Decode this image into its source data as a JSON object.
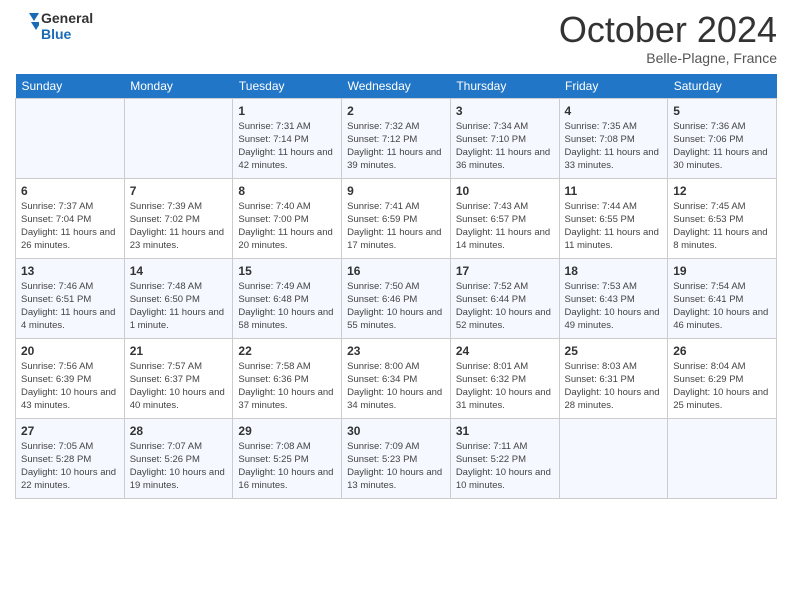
{
  "header": {
    "logo_general": "General",
    "logo_blue": "Blue",
    "month": "October 2024",
    "location": "Belle-Plagne, France"
  },
  "days_of_week": [
    "Sunday",
    "Monday",
    "Tuesday",
    "Wednesday",
    "Thursday",
    "Friday",
    "Saturday"
  ],
  "weeks": [
    [
      {
        "day": "",
        "empty": true
      },
      {
        "day": "",
        "empty": true
      },
      {
        "day": "1",
        "sunrise": "Sunrise: 7:31 AM",
        "sunset": "Sunset: 7:14 PM",
        "daylight": "Daylight: 11 hours and 42 minutes."
      },
      {
        "day": "2",
        "sunrise": "Sunrise: 7:32 AM",
        "sunset": "Sunset: 7:12 PM",
        "daylight": "Daylight: 11 hours and 39 minutes."
      },
      {
        "day": "3",
        "sunrise": "Sunrise: 7:34 AM",
        "sunset": "Sunset: 7:10 PM",
        "daylight": "Daylight: 11 hours and 36 minutes."
      },
      {
        "day": "4",
        "sunrise": "Sunrise: 7:35 AM",
        "sunset": "Sunset: 7:08 PM",
        "daylight": "Daylight: 11 hours and 33 minutes."
      },
      {
        "day": "5",
        "sunrise": "Sunrise: 7:36 AM",
        "sunset": "Sunset: 7:06 PM",
        "daylight": "Daylight: 11 hours and 30 minutes."
      }
    ],
    [
      {
        "day": "6",
        "sunrise": "Sunrise: 7:37 AM",
        "sunset": "Sunset: 7:04 PM",
        "daylight": "Daylight: 11 hours and 26 minutes."
      },
      {
        "day": "7",
        "sunrise": "Sunrise: 7:39 AM",
        "sunset": "Sunset: 7:02 PM",
        "daylight": "Daylight: 11 hours and 23 minutes."
      },
      {
        "day": "8",
        "sunrise": "Sunrise: 7:40 AM",
        "sunset": "Sunset: 7:00 PM",
        "daylight": "Daylight: 11 hours and 20 minutes."
      },
      {
        "day": "9",
        "sunrise": "Sunrise: 7:41 AM",
        "sunset": "Sunset: 6:59 PM",
        "daylight": "Daylight: 11 hours and 17 minutes."
      },
      {
        "day": "10",
        "sunrise": "Sunrise: 7:43 AM",
        "sunset": "Sunset: 6:57 PM",
        "daylight": "Daylight: 11 hours and 14 minutes."
      },
      {
        "day": "11",
        "sunrise": "Sunrise: 7:44 AM",
        "sunset": "Sunset: 6:55 PM",
        "daylight": "Daylight: 11 hours and 11 minutes."
      },
      {
        "day": "12",
        "sunrise": "Sunrise: 7:45 AM",
        "sunset": "Sunset: 6:53 PM",
        "daylight": "Daylight: 11 hours and 8 minutes."
      }
    ],
    [
      {
        "day": "13",
        "sunrise": "Sunrise: 7:46 AM",
        "sunset": "Sunset: 6:51 PM",
        "daylight": "Daylight: 11 hours and 4 minutes."
      },
      {
        "day": "14",
        "sunrise": "Sunrise: 7:48 AM",
        "sunset": "Sunset: 6:50 PM",
        "daylight": "Daylight: 11 hours and 1 minute."
      },
      {
        "day": "15",
        "sunrise": "Sunrise: 7:49 AM",
        "sunset": "Sunset: 6:48 PM",
        "daylight": "Daylight: 10 hours and 58 minutes."
      },
      {
        "day": "16",
        "sunrise": "Sunrise: 7:50 AM",
        "sunset": "Sunset: 6:46 PM",
        "daylight": "Daylight: 10 hours and 55 minutes."
      },
      {
        "day": "17",
        "sunrise": "Sunrise: 7:52 AM",
        "sunset": "Sunset: 6:44 PM",
        "daylight": "Daylight: 10 hours and 52 minutes."
      },
      {
        "day": "18",
        "sunrise": "Sunrise: 7:53 AM",
        "sunset": "Sunset: 6:43 PM",
        "daylight": "Daylight: 10 hours and 49 minutes."
      },
      {
        "day": "19",
        "sunrise": "Sunrise: 7:54 AM",
        "sunset": "Sunset: 6:41 PM",
        "daylight": "Daylight: 10 hours and 46 minutes."
      }
    ],
    [
      {
        "day": "20",
        "sunrise": "Sunrise: 7:56 AM",
        "sunset": "Sunset: 6:39 PM",
        "daylight": "Daylight: 10 hours and 43 minutes."
      },
      {
        "day": "21",
        "sunrise": "Sunrise: 7:57 AM",
        "sunset": "Sunset: 6:37 PM",
        "daylight": "Daylight: 10 hours and 40 minutes."
      },
      {
        "day": "22",
        "sunrise": "Sunrise: 7:58 AM",
        "sunset": "Sunset: 6:36 PM",
        "daylight": "Daylight: 10 hours and 37 minutes."
      },
      {
        "day": "23",
        "sunrise": "Sunrise: 8:00 AM",
        "sunset": "Sunset: 6:34 PM",
        "daylight": "Daylight: 10 hours and 34 minutes."
      },
      {
        "day": "24",
        "sunrise": "Sunrise: 8:01 AM",
        "sunset": "Sunset: 6:32 PM",
        "daylight": "Daylight: 10 hours and 31 minutes."
      },
      {
        "day": "25",
        "sunrise": "Sunrise: 8:03 AM",
        "sunset": "Sunset: 6:31 PM",
        "daylight": "Daylight: 10 hours and 28 minutes."
      },
      {
        "day": "26",
        "sunrise": "Sunrise: 8:04 AM",
        "sunset": "Sunset: 6:29 PM",
        "daylight": "Daylight: 10 hours and 25 minutes."
      }
    ],
    [
      {
        "day": "27",
        "sunrise": "Sunrise: 7:05 AM",
        "sunset": "Sunset: 5:28 PM",
        "daylight": "Daylight: 10 hours and 22 minutes."
      },
      {
        "day": "28",
        "sunrise": "Sunrise: 7:07 AM",
        "sunset": "Sunset: 5:26 PM",
        "daylight": "Daylight: 10 hours and 19 minutes."
      },
      {
        "day": "29",
        "sunrise": "Sunrise: 7:08 AM",
        "sunset": "Sunset: 5:25 PM",
        "daylight": "Daylight: 10 hours and 16 minutes."
      },
      {
        "day": "30",
        "sunrise": "Sunrise: 7:09 AM",
        "sunset": "Sunset: 5:23 PM",
        "daylight": "Daylight: 10 hours and 13 minutes."
      },
      {
        "day": "31",
        "sunrise": "Sunrise: 7:11 AM",
        "sunset": "Sunset: 5:22 PM",
        "daylight": "Daylight: 10 hours and 10 minutes."
      },
      {
        "day": "",
        "empty": true
      },
      {
        "day": "",
        "empty": true
      }
    ]
  ]
}
